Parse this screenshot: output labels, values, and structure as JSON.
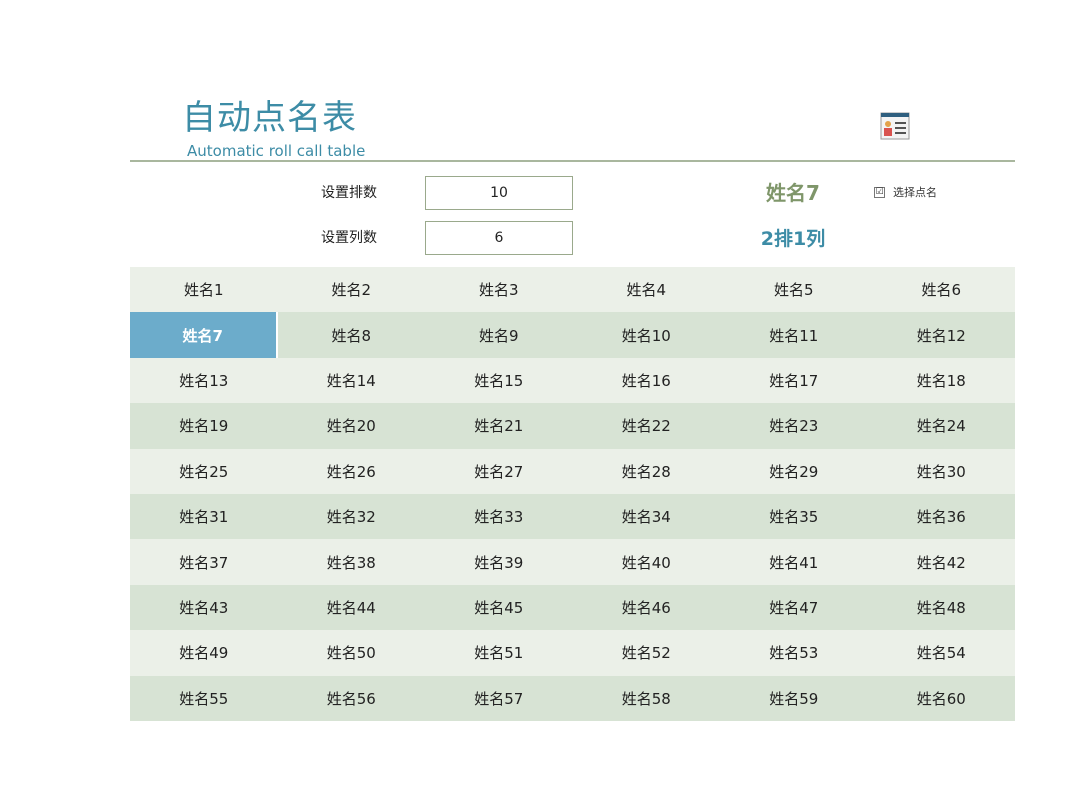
{
  "header": {
    "title_cn": "自动点名表",
    "title_en": "Automatic roll call table",
    "icon": "id-card-icon"
  },
  "settings": {
    "rows_label": "设置排数",
    "rows_value": "10",
    "cols_label": "设置列数",
    "cols_value": "6"
  },
  "result": {
    "name": "姓名7",
    "position": "2排1列"
  },
  "checkbox": {
    "label": "选择点名",
    "checked": true,
    "mark": "☑"
  },
  "grid": {
    "selected": "姓名7",
    "names": [
      "姓名1",
      "姓名2",
      "姓名3",
      "姓名4",
      "姓名5",
      "姓名6",
      "姓名7",
      "姓名8",
      "姓名9",
      "姓名10",
      "姓名11",
      "姓名12",
      "姓名13",
      "姓名14",
      "姓名15",
      "姓名16",
      "姓名17",
      "姓名18",
      "姓名19",
      "姓名20",
      "姓名21",
      "姓名22",
      "姓名23",
      "姓名24",
      "姓名25",
      "姓名26",
      "姓名27",
      "姓名28",
      "姓名29",
      "姓名30",
      "姓名31",
      "姓名32",
      "姓名33",
      "姓名34",
      "姓名35",
      "姓名36",
      "姓名37",
      "姓名38",
      "姓名39",
      "姓名40",
      "姓名41",
      "姓名42",
      "姓名43",
      "姓名44",
      "姓名45",
      "姓名46",
      "姓名47",
      "姓名48",
      "姓名49",
      "姓名50",
      "姓名51",
      "姓名52",
      "姓名53",
      "姓名54",
      "姓名55",
      "姓名56",
      "姓名57",
      "姓名58",
      "姓名59",
      "姓名60"
    ]
  },
  "colors": {
    "accent": "#3d8ca6",
    "result_name": "#7f966a",
    "selected_cell": "#6caccb",
    "row_light": "#ebf0e8",
    "row_dark": "#d7e3d4"
  }
}
